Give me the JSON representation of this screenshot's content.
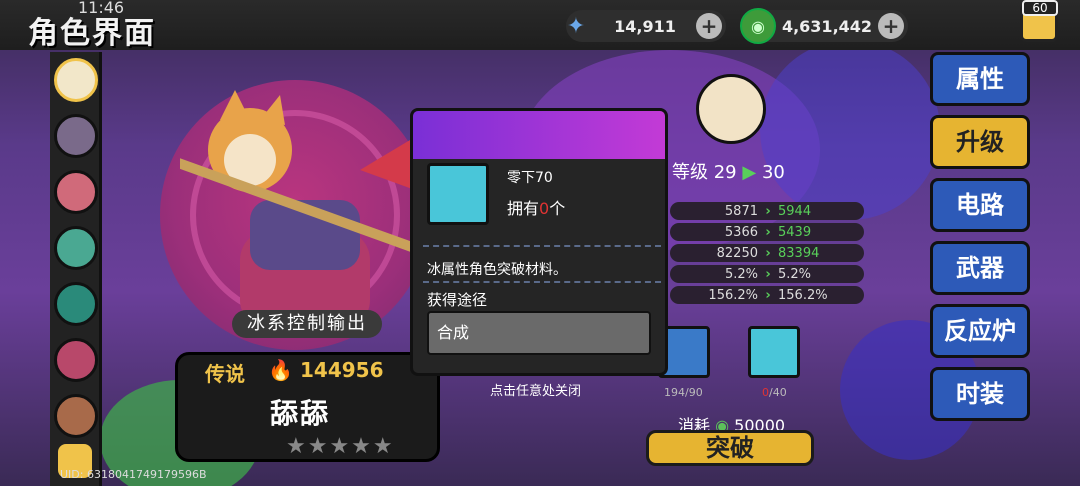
{
  "status": {
    "time": "11:46",
    "fps": "60"
  },
  "header": {
    "title": "角色界面"
  },
  "currencies": [
    {
      "icon": "star-crystal-icon",
      "value": "14,911"
    },
    {
      "icon": "green-coin-icon",
      "value": "4,631,442"
    }
  ],
  "plus_label": "+",
  "character": {
    "role": "冰系控制输出",
    "rarity": "传说",
    "power": "144956",
    "name": "舔舔",
    "stars": "★★★★★",
    "uid": "UID: 6318041749179596B"
  },
  "level": {
    "prefix": "等级",
    "current": "29",
    "next": "30"
  },
  "stats": [
    {
      "from": "5871",
      "to": "5944"
    },
    {
      "from": "5366",
      "to": "5439"
    },
    {
      "from": "82250",
      "to": "83394"
    },
    {
      "from": "5.2%",
      "to": "5.2%"
    },
    {
      "from": "156.2%",
      "to": "156.2%"
    }
  ],
  "materials": [
    {
      "icon": "food-material-icon",
      "count_have": "194",
      "count_need": "/90"
    },
    {
      "icon": "pipe-material-icon",
      "count_have": "0",
      "count_need": "/40"
    }
  ],
  "cost": {
    "label": "消耗",
    "value": "50000"
  },
  "break_button": "突破",
  "side_tabs": [
    "属性",
    "升级",
    "电路",
    "武器",
    "反应炉",
    "时装"
  ],
  "popup": {
    "item_name": "零下70",
    "own_prefix": "拥有",
    "own_count": "0",
    "own_suffix": "个",
    "description": "冰属性角色突破材料。",
    "route_label": "获得途径",
    "route_button": "合成",
    "close_hint": "点击任意处关闭"
  },
  "colors": {
    "accent": "#e6b431",
    "tab_blue": "#2d5ab8",
    "green": "#59d05a",
    "red": "#e03333"
  }
}
